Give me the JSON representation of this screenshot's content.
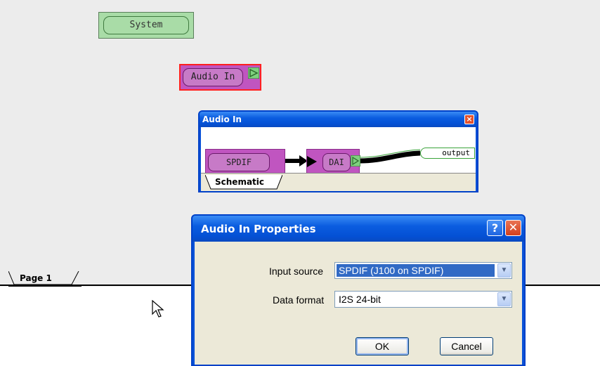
{
  "canvas": {
    "blocks": {
      "system": "System",
      "audio_in": "Audio In"
    },
    "page_tab": "Page 1"
  },
  "schematic_window": {
    "title": "Audio In",
    "blocks": {
      "spdif": "SPDIF",
      "dai": "DAI",
      "output": "output"
    },
    "tab": "Schematic",
    "close_icon": "close-icon"
  },
  "properties_dialog": {
    "title": "Audio In Properties",
    "help_symbol": "?",
    "close_symbol": "✕",
    "fields": {
      "input_source": {
        "label": "Input source",
        "value": "SPDIF (J100 on SPDIF)"
      },
      "data_format": {
        "label": "Data format",
        "value": "I2S 24-bit"
      }
    },
    "buttons": {
      "ok": "OK",
      "cancel": "Cancel"
    }
  },
  "colors": {
    "system_block": "#a9dca7",
    "audio_block": "#c055c0",
    "selection_border": "#ff2020",
    "titlebar": "#0a52d8"
  }
}
